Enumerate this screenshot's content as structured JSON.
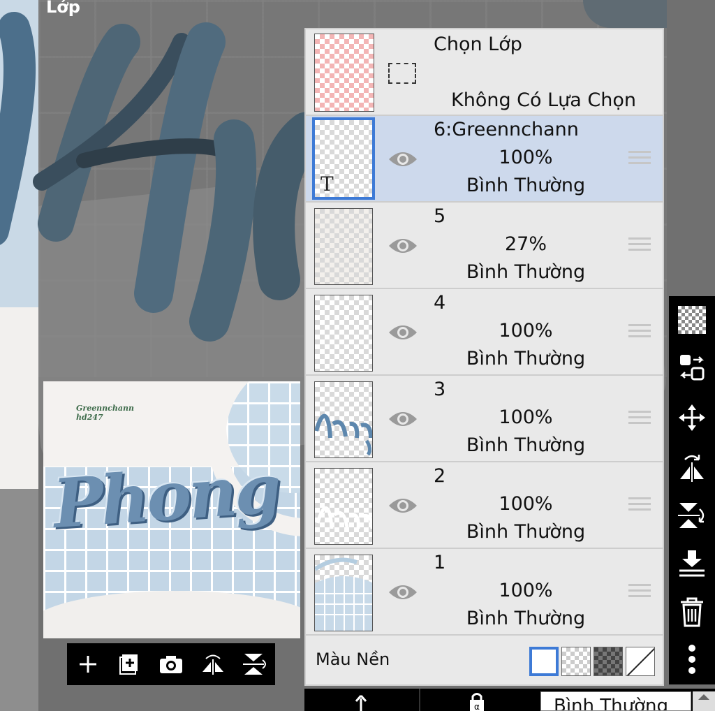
{
  "app": {
    "title": "Lớp"
  },
  "preview": {
    "signature_line1": "Greennchann",
    "signature_line2": "hd247",
    "artwork_word": "Phong"
  },
  "preview_toolbar": {
    "items": [
      {
        "icon": "plus-icon",
        "label": "add-layer"
      },
      {
        "icon": "add-layer-copy-icon",
        "label": "add-layer-copy"
      },
      {
        "icon": "camera-icon",
        "label": "import-photo"
      },
      {
        "icon": "flip-horizontal-icon",
        "label": "flip-horizontal"
      },
      {
        "icon": "flip-vertical-icon",
        "label": "flip-vertical"
      }
    ]
  },
  "selection": {
    "title": "Chọn Lớp",
    "status": "Không Có Lựa Chọn"
  },
  "layers": [
    {
      "name": "6:Greennchann",
      "opacity": "100%",
      "blend": "Bình Thường",
      "selected": true,
      "type": "text",
      "text_marker": "T"
    },
    {
      "name": "5",
      "opacity": "27%",
      "blend": "Bình Thường",
      "selected": false
    },
    {
      "name": "4",
      "opacity": "100%",
      "blend": "Bình Thường",
      "selected": false
    },
    {
      "name": "3",
      "opacity": "100%",
      "blend": "Bình Thường",
      "selected": false
    },
    {
      "name": "2",
      "opacity": "100%",
      "blend": "Bình Thường",
      "selected": false
    },
    {
      "name": "1",
      "opacity": "100%",
      "blend": "Bình Thường",
      "selected": false
    }
  ],
  "background": {
    "label": "Màu Nền",
    "options": [
      "white",
      "transparent",
      "dark-checker",
      "none"
    ],
    "selected": "white"
  },
  "right_toolbar": {
    "items": [
      "checkerboard-icon",
      "swap-layer-icon",
      "move-icon",
      "flip-horizontal-icon",
      "flip-vertical-icon",
      "merge-down-icon",
      "trash-icon",
      "more-vertical-icon"
    ]
  },
  "bottom_bar": {
    "blend_mode": "Bình Thường",
    "items": [
      "clip-icon",
      "lock-alpha-icon"
    ]
  },
  "colors": {
    "accent": "#3d7ad6",
    "selected_row": "#cdd9ec",
    "panel": "#e9e9e9",
    "toolbar": "#000000"
  }
}
